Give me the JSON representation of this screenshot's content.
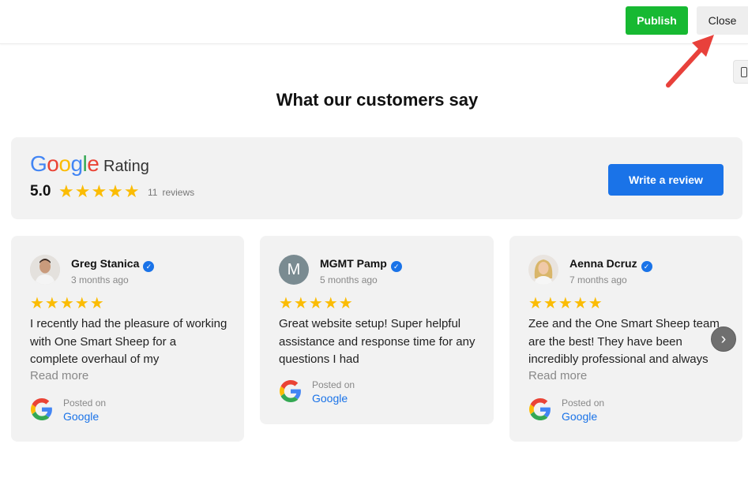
{
  "toolbar": {
    "publish_label": "Publish",
    "close_label": "Close"
  },
  "section": {
    "title": "What our customers say"
  },
  "rating_header": {
    "brand": [
      "G",
      "o",
      "o",
      "g",
      "l",
      "e"
    ],
    "rating_label": "Rating",
    "score": "5.0",
    "stars": "★★★★★",
    "review_count": "11",
    "review_word": "reviews",
    "write_review_label": "Write a review"
  },
  "reviews": [
    {
      "name": "Greg Stanica",
      "time": "3 months ago",
      "stars": "★★★★★",
      "text": "I recently had the pleasure of working with One Smart Sheep for a complete overhaul of my",
      "read_more": "Read more",
      "posted_on": "Posted on",
      "source": "Google",
      "avatar_icon": "person-photo-icon"
    },
    {
      "name": "MGMT Pamp",
      "time": "5 months ago",
      "stars": "★★★★★",
      "text": "Great website setup! Super helpful assistance and response time for any questions I had",
      "posted_on": "Posted on",
      "source": "Google",
      "avatar_letter": "M"
    },
    {
      "name": "Aenna Dcruz",
      "time": "7 months ago",
      "stars": "★★★★★",
      "text": "Zee and the One Smart Sheep team are the best! They have been incredibly professional and always",
      "read_more": "Read more",
      "posted_on": "Posted on",
      "source": "Google",
      "avatar_icon": "person-photo-icon"
    }
  ],
  "carousel": {
    "next_glyph": "›"
  },
  "colors": {
    "publish": "#17b932",
    "accent_blue": "#1a73e8",
    "star": "#fbbc04",
    "panel": "#f2f2f2",
    "annotation_arrow": "#e8413b"
  }
}
